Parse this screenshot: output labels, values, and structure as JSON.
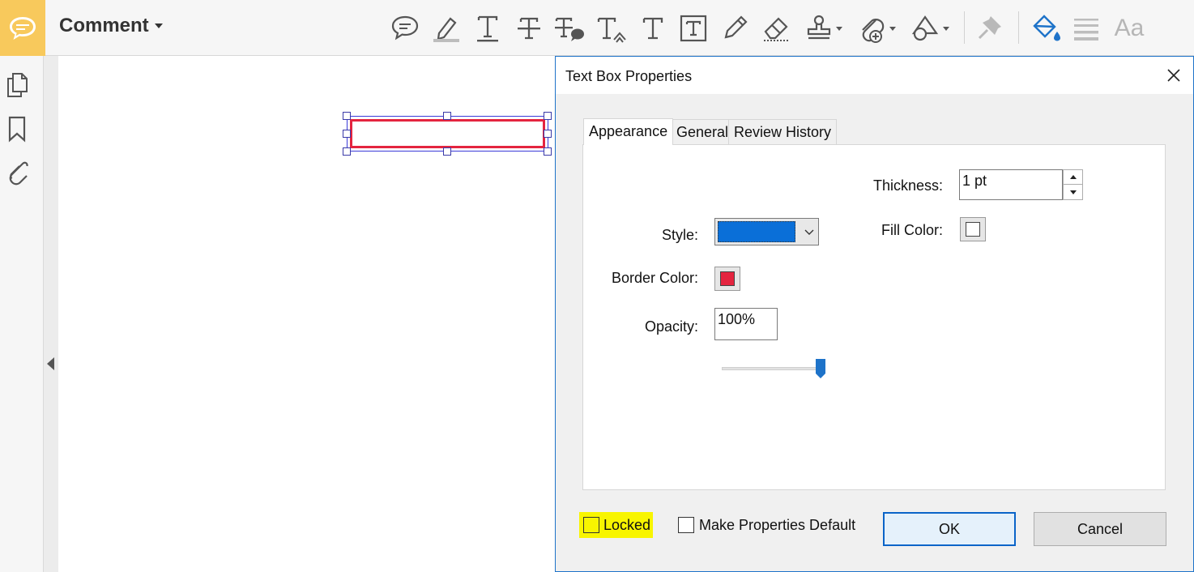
{
  "toolbar": {
    "title": "Comment",
    "tools": [
      {
        "icon": "sticky-note-icon"
      },
      {
        "icon": "highlight-icon"
      },
      {
        "icon": "underline-text-icon"
      },
      {
        "icon": "strikethrough-icon"
      },
      {
        "icon": "replace-text-icon"
      },
      {
        "icon": "insert-text-icon"
      },
      {
        "icon": "add-text-comment-icon"
      },
      {
        "icon": "text-box-icon"
      },
      {
        "icon": "pencil-icon"
      },
      {
        "icon": "eraser-icon"
      },
      {
        "icon": "stamp-icon"
      },
      {
        "icon": "attach-file-icon"
      },
      {
        "icon": "drawing-tools-icon"
      },
      {
        "icon": "pin-icon"
      },
      {
        "icon": "fill-color-icon"
      },
      {
        "icon": "line-properties-icon"
      },
      {
        "icon": "text-properties-icon"
      }
    ],
    "text_properties_label": "Aa"
  },
  "leftnav": {
    "items": [
      {
        "icon": "page-thumbnails-icon"
      },
      {
        "icon": "bookmarks-icon"
      },
      {
        "icon": "attachments-icon"
      }
    ]
  },
  "colors": {
    "accent": "#1e73c9",
    "comment_tile": "#f8c95c",
    "style_swatch": "#0a6fd8",
    "border_color": "#e4243f",
    "fill_color": "#ffffff",
    "highlight": "#f8f500"
  },
  "dialog": {
    "title": "Text Box Properties",
    "tabs": [
      "Appearance",
      "General",
      "Review History"
    ],
    "active_tab": "Appearance",
    "fields": {
      "thickness_label": "Thickness:",
      "thickness_value": "1 pt",
      "style_label": "Style:",
      "fill_color_label": "Fill Color:",
      "border_color_label": "Border Color:",
      "opacity_label": "Opacity:",
      "opacity_value": "100%",
      "opacity_slider": 100
    },
    "locked_label": "Locked",
    "locked_checked": false,
    "make_default_label": "Make Properties Default",
    "make_default_checked": false,
    "ok_label": "OK",
    "cancel_label": "Cancel"
  }
}
